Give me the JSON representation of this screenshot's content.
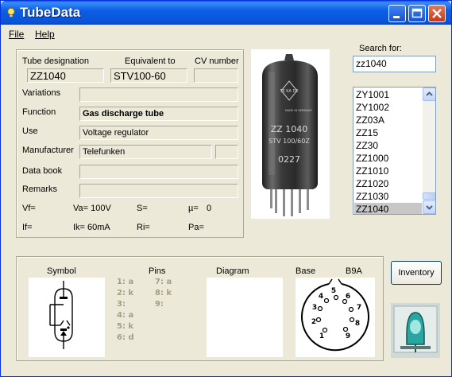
{
  "app": {
    "title": "TubeData",
    "menus": [
      {
        "label": "File"
      },
      {
        "label": "Help"
      }
    ]
  },
  "details": {
    "labels": {
      "designation": "Tube designation",
      "equivalent": "Equivalent to",
      "cv": "CV number",
      "variations": "Variations",
      "function": "Function",
      "use": "Use",
      "manufacturer": "Manufacturer",
      "databook": "Data book",
      "remarks": "Remarks"
    },
    "designation": "ZZ1040",
    "equivalent": "STV100-60",
    "cv": "",
    "variations": "",
    "function": "Gas discharge tube",
    "use": "Voltage regulator",
    "manufacturer": "Telefunken",
    "manufacturer_extra": "",
    "databook": "",
    "remarks": ""
  },
  "params": {
    "vf": "Vf=",
    "va": "Va= 100V",
    "s": "S=",
    "mu": "µ=",
    "mu_val": "0",
    "if": "If=",
    "ik": "Ik= 60mA",
    "ri": "Ri=",
    "pa": "Pa="
  },
  "search": {
    "label": "Search for:",
    "value": "zz1040"
  },
  "tube_list": {
    "items": [
      "ZY1001",
      "ZY1002",
      "ZZ03A",
      "ZZ15",
      "ZZ30",
      "ZZ1000",
      "ZZ1010",
      "ZZ1020",
      "ZZ1030",
      "ZZ1040"
    ],
    "selected": "ZZ1040"
  },
  "photo_text": {
    "line1": "ZZ 1040",
    "line2": "STV 100/60Z",
    "line3": "0227",
    "brand": "TE KA DE",
    "made": "MADE IN GERMANY"
  },
  "bottom": {
    "labels": {
      "symbol": "Symbol",
      "pins": "Pins",
      "diagram": "Diagram",
      "base": "Base",
      "base_type": "B9A"
    },
    "pins": [
      "1: a",
      "2: k",
      "3:",
      "4: a",
      "5: k",
      "6: d",
      "7: a",
      "8: k",
      "9:"
    ],
    "base_numbers": [
      "1",
      "2",
      "3",
      "4",
      "5",
      "6",
      "7",
      "8",
      "9"
    ]
  },
  "inventory_label": "Inventory",
  "colors": {
    "title_bar": "#0a5ee8",
    "window_bg": "#ece9d8",
    "pin_text": "#a59e84",
    "selection": "#c7c7c7"
  }
}
